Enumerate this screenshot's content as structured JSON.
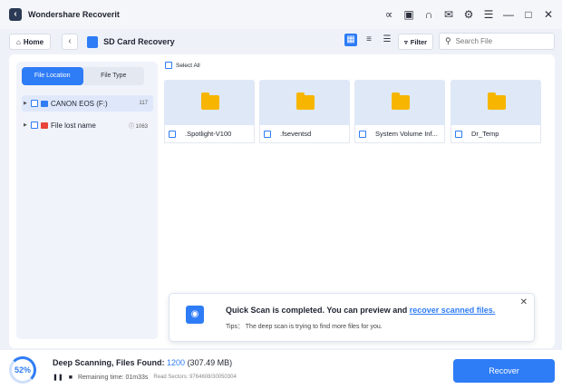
{
  "window": {
    "title": "Wondershare Recoverit"
  },
  "toolbar": {
    "home_label": "Home",
    "location_title": "SD Card Recovery",
    "filter_label": "Filter",
    "search_placeholder": "Search File"
  },
  "sidebar": {
    "tabs": [
      "File Location",
      "File Type"
    ],
    "items": [
      {
        "label": "CANON EOS (F:)",
        "count": "117"
      },
      {
        "label": "File lost name",
        "count": "1063"
      }
    ]
  },
  "content": {
    "select_all_label": "Select All",
    "files": [
      {
        "name": ".Spotlight-V100"
      },
      {
        "name": ".fseventsd"
      },
      {
        "name": "System Volume Inf..."
      },
      {
        "name": "Dr_Temp"
      }
    ]
  },
  "notice": {
    "title_prefix": "Quick Scan is completed. You can preview and ",
    "title_link": "recover scanned files.",
    "tip": "Tips： The deep scan is trying to find more files for you."
  },
  "status": {
    "progress_label": "52%",
    "progress_fraction": 0.52,
    "scan_label": "Deep Scanning, Files Found: ",
    "files_found": "1200",
    "files_size": "(307.49 MB)",
    "remaining": "Remaining time:  01m33s",
    "sectors": "Read Sectors: 9764608/30050304",
    "recover_label": "Recover"
  },
  "colors": {
    "accent": "#2e7cf6",
    "folder": "#f7b500"
  },
  "icons": [
    "user-icon",
    "inbox-icon",
    "headset-icon",
    "mail-icon",
    "settings-icon",
    "menu-icon",
    "minimize-icon",
    "close-icon"
  ]
}
